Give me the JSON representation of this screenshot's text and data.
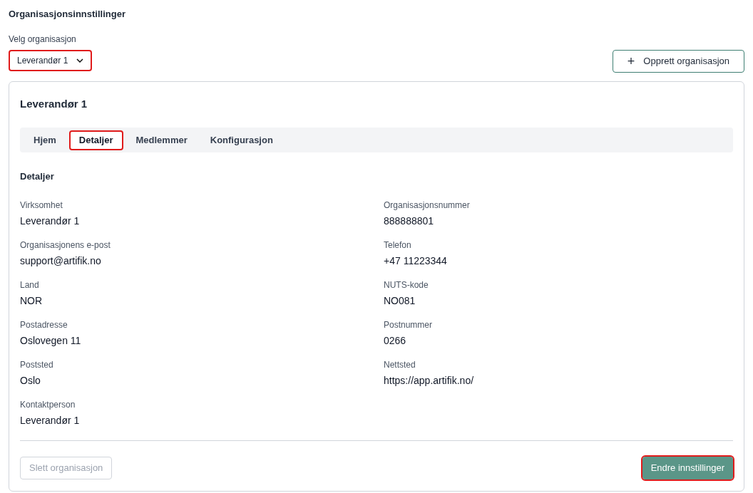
{
  "page_title": "Organisasjonsinnstillinger",
  "org_select": {
    "label": "Velg organisasjon",
    "value": "Leverandør 1",
    "highlighted": true
  },
  "create_button": {
    "icon": "+",
    "label": "Opprett organisasjon"
  },
  "card": {
    "title": "Leverandør 1",
    "tabs": [
      {
        "label": "Hjem",
        "selected": false,
        "highlighted": false
      },
      {
        "label": "Detaljer",
        "selected": true,
        "highlighted": true
      },
      {
        "label": "Medlemmer",
        "selected": false,
        "highlighted": false
      },
      {
        "label": "Konfigurasjon",
        "selected": false,
        "highlighted": false
      }
    ],
    "section_title": "Detaljer",
    "fields": [
      {
        "label": "Virksomhet",
        "value": "Leverandør 1"
      },
      {
        "label": "Organisasjonsnummer",
        "value": "888888801"
      },
      {
        "label": "Organisasjonens e-post",
        "value": "support@artifik.no"
      },
      {
        "label": "Telefon",
        "value": "+47 11223344"
      },
      {
        "label": "Land",
        "value": "NOR"
      },
      {
        "label": "NUTS-kode",
        "value": "NO081"
      },
      {
        "label": "Postadresse",
        "value": "Oslovegen 11"
      },
      {
        "label": "Postnummer",
        "value": "0266"
      },
      {
        "label": "Poststed",
        "value": "Oslo"
      },
      {
        "label": "Nettsted",
        "value": "https://app.artifik.no/"
      },
      {
        "label": "Kontaktperson",
        "value": "Leverandør 1"
      }
    ],
    "delete_button": {
      "label": "Slett organisasjon",
      "disabled": true
    },
    "edit_button": {
      "label": "Endre innstillinger",
      "highlighted": true
    }
  }
}
